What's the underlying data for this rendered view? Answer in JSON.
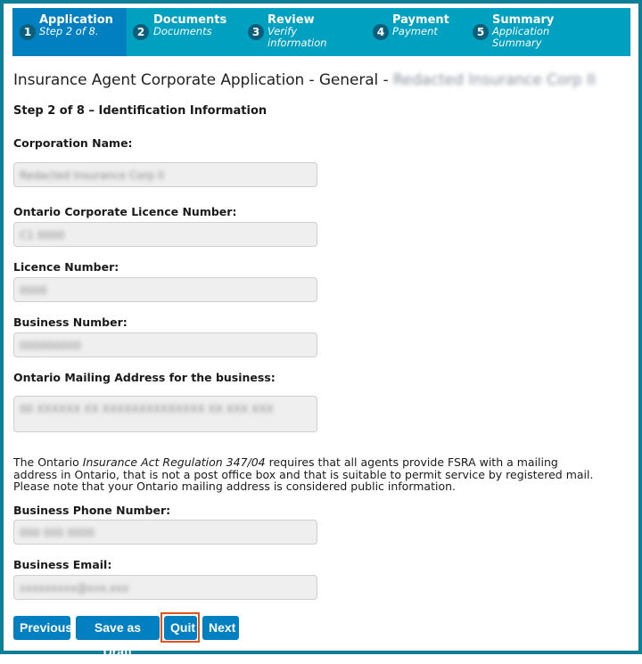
{
  "stepper": {
    "steps": [
      {
        "num": "1",
        "title": "Application",
        "sub": "Step 2 of 8.",
        "active": true
      },
      {
        "num": "2",
        "title": "Documents",
        "sub": "Documents",
        "active": false
      },
      {
        "num": "3",
        "title": "Review",
        "sub": "Verify information",
        "active": false
      },
      {
        "num": "4",
        "title": "Payment",
        "sub": "Payment",
        "active": false
      },
      {
        "num": "5",
        "title": "Summary",
        "sub": "Application Summary",
        "active": false
      }
    ]
  },
  "page": {
    "title": "Insurance Agent Corporate Application - General - ",
    "title_redacted": "Redacted Insurance Corp II",
    "step_heading": "Step 2 of 8 – Identification Information"
  },
  "fields": {
    "corporation_name": {
      "label": "Corporation Name:",
      "value": "Redacted Insurance Corp II"
    },
    "corporate_licence": {
      "label": "Ontario Corporate Licence Number:",
      "value": "C1 0000"
    },
    "licence_number": {
      "label": "Licence Number:",
      "value": "0000"
    },
    "business_number": {
      "label": "Business Number:",
      "value": "000000000"
    },
    "mailing_address": {
      "label": "Ontario Mailing Address for the business:",
      "value": "00 XXXXXX XX XXXXXXXXXXXXXX XX XXX XXX"
    },
    "phone": {
      "label": "Business Phone Number:",
      "value": "000 000 0000"
    },
    "email": {
      "label": "Business Email:",
      "value": "xxxxxxxxx@xxx.xxx"
    }
  },
  "notice": {
    "pre": "The Ontario ",
    "italic": "Insurance Act Regulation 347/04",
    "post": " requires that all agents provide FSRA with a mailing address in Ontario, that is not a post  office box and that is suitable to permit service by registered mail.  Please note that your Ontario mailing address is considered public information."
  },
  "buttons": {
    "previous": "Previous",
    "save_draft": "Save as Draft",
    "quit": "Quit",
    "next": "Next"
  }
}
